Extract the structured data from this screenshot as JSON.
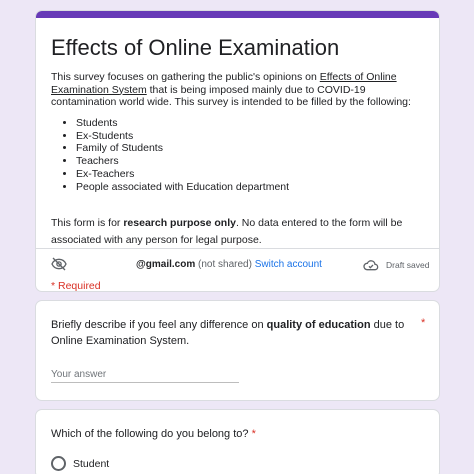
{
  "header": {
    "title": "Effects of Online Examination",
    "intro_before_link": "This survey focuses on gathering the public's opinions on ",
    "intro_link": "Effects of Online Examination System",
    "intro_after_link": " that is being imposed mainly due to COVID-19 contamination world wide. This survey is intended to be filled by the following:",
    "audience": [
      "Students",
      "Ex-Students",
      "Family of Students",
      "Teachers",
      "Ex-Teachers",
      "People associated with Education department"
    ],
    "purpose_before": "This form is for ",
    "purpose_bold": "research purpose only",
    "purpose_after": ". No data entered to the form will be associated with any person for legal purpose.",
    "account_email": "@gmail.com",
    "not_shared": "(not shared)",
    "switch_account": "Switch account",
    "draft_saved": "Draft saved",
    "required_note": "* Required"
  },
  "question1": {
    "text_before": "Briefly describe if you feel any difference on ",
    "text_bold": "quality of education",
    "text_after": " due to Online Examination System.",
    "required_mark": "*",
    "answer_placeholder": "Your answer",
    "answer_value": ""
  },
  "question2": {
    "text": "Which of the following do you belong to?",
    "required_mark": "*",
    "options": [
      "Student"
    ]
  },
  "colors": {
    "accent": "#673ab7",
    "background": "#ede7f6",
    "required": "#d93025",
    "link": "#1a73e8"
  },
  "icons": {
    "visibility": "eye-off-icon",
    "cloud": "cloud-done-icon"
  }
}
